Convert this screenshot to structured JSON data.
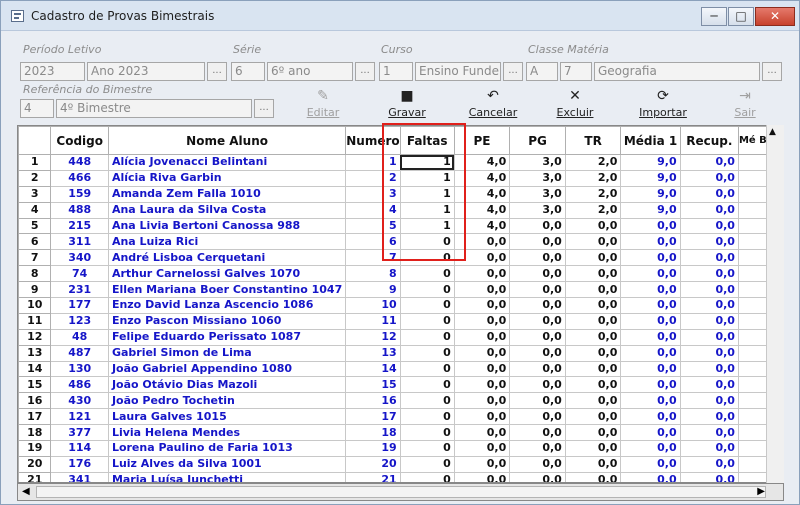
{
  "window": {
    "title": "Cadastro de Provas Bimestrais",
    "min": "─",
    "max": "□",
    "close": "✕"
  },
  "filters": {
    "periodo_label": "Período Letivo",
    "periodo_code": "2023",
    "periodo_name": "Ano 2023",
    "serie_label": "Série",
    "serie_code": "6",
    "serie_name": "6º ano",
    "curso_label": "Curso",
    "curso_code": "1",
    "curso_name": "Ensino Funde",
    "classe_label": "Classe Matéria",
    "classe_code": "A",
    "materia_code": "7",
    "materia_name": "Geografia",
    "ref_label": "Referência do Bimestre",
    "ref_code": "4",
    "ref_name": "4º Bimestre",
    "ellipsis": "..."
  },
  "toolbar": {
    "editar": "Editar",
    "gravar": "Gravar",
    "cancelar": "Cancelar",
    "excluir": "Excluir",
    "importar": "Importar",
    "sair": "Sair"
  },
  "grid": {
    "headers": [
      "Codigo",
      "Nome Aluno",
      "Numero",
      "Faltas",
      "PE",
      "PG",
      "TR",
      "Média 1",
      "Recup.",
      "Mé Bi"
    ],
    "rows": [
      {
        "n": "1",
        "codigo": "448",
        "nome": "Alícia Jovenacci Belintani",
        "numero": "1",
        "faltas": "1",
        "pe": "4,0",
        "pg": "3,0",
        "tr": "2,0",
        "media": "9,0",
        "recup": "0,0"
      },
      {
        "n": "2",
        "codigo": "466",
        "nome": "Alícia Riva Garbin",
        "numero": "2",
        "faltas": "1",
        "pe": "4,0",
        "pg": "3,0",
        "tr": "2,0",
        "media": "9,0",
        "recup": "0,0"
      },
      {
        "n": "3",
        "codigo": "159",
        "nome": "Amanda Zem Falla 1010",
        "numero": "3",
        "faltas": "1",
        "pe": "4,0",
        "pg": "3,0",
        "tr": "2,0",
        "media": "9,0",
        "recup": "0,0"
      },
      {
        "n": "4",
        "codigo": "488",
        "nome": "Ana Laura da Silva Costa",
        "numero": "4",
        "faltas": "1",
        "pe": "4,0",
        "pg": "3,0",
        "tr": "2,0",
        "media": "9,0",
        "recup": "0,0"
      },
      {
        "n": "5",
        "codigo": "215",
        "nome": "Ana Livia Bertoni Canossa 988",
        "numero": "5",
        "faltas": "1",
        "pe": "4,0",
        "pg": "0,0",
        "tr": "0,0",
        "media": "0,0",
        "recup": "0,0"
      },
      {
        "n": "6",
        "codigo": "311",
        "nome": "Ana Luiza Rici",
        "numero": "6",
        "faltas": "0",
        "pe": "0,0",
        "pg": "0,0",
        "tr": "0,0",
        "media": "0,0",
        "recup": "0,0"
      },
      {
        "n": "7",
        "codigo": "340",
        "nome": "André Lisboa Cerquetani",
        "numero": "7",
        "faltas": "0",
        "pe": "0,0",
        "pg": "0,0",
        "tr": "0,0",
        "media": "0,0",
        "recup": "0,0"
      },
      {
        "n": "8",
        "codigo": "74",
        "nome": "Arthur Carnelossi Galves 1070",
        "numero": "8",
        "faltas": "0",
        "pe": "0,0",
        "pg": "0,0",
        "tr": "0,0",
        "media": "0,0",
        "recup": "0,0"
      },
      {
        "n": "9",
        "codigo": "231",
        "nome": "Ellen Mariana Boer Constantino 1047",
        "numero": "9",
        "faltas": "0",
        "pe": "0,0",
        "pg": "0,0",
        "tr": "0,0",
        "media": "0,0",
        "recup": "0,0"
      },
      {
        "n": "10",
        "codigo": "177",
        "nome": "Enzo David Lanza Ascencio 1086",
        "numero": "10",
        "faltas": "0",
        "pe": "0,0",
        "pg": "0,0",
        "tr": "0,0",
        "media": "0,0",
        "recup": "0,0"
      },
      {
        "n": "11",
        "codigo": "123",
        "nome": "Enzo Pascon Missiano 1060",
        "numero": "11",
        "faltas": "0",
        "pe": "0,0",
        "pg": "0,0",
        "tr": "0,0",
        "media": "0,0",
        "recup": "0,0"
      },
      {
        "n": "12",
        "codigo": "48",
        "nome": "Felipe Eduardo Perissato 1087",
        "numero": "12",
        "faltas": "0",
        "pe": "0,0",
        "pg": "0,0",
        "tr": "0,0",
        "media": "0,0",
        "recup": "0,0"
      },
      {
        "n": "13",
        "codigo": "487",
        "nome": "Gabriel Simon de Lima",
        "numero": "13",
        "faltas": "0",
        "pe": "0,0",
        "pg": "0,0",
        "tr": "0,0",
        "media": "0,0",
        "recup": "0,0"
      },
      {
        "n": "14",
        "codigo": "130",
        "nome": "João Gabriel Appendino 1080",
        "numero": "14",
        "faltas": "0",
        "pe": "0,0",
        "pg": "0,0",
        "tr": "0,0",
        "media": "0,0",
        "recup": "0,0"
      },
      {
        "n": "15",
        "codigo": "486",
        "nome": "João Otávio Dias Mazoli",
        "numero": "15",
        "faltas": "0",
        "pe": "0,0",
        "pg": "0,0",
        "tr": "0,0",
        "media": "0,0",
        "recup": "0,0"
      },
      {
        "n": "16",
        "codigo": "430",
        "nome": "João Pedro Tochetin",
        "numero": "16",
        "faltas": "0",
        "pe": "0,0",
        "pg": "0,0",
        "tr": "0,0",
        "media": "0,0",
        "recup": "0,0"
      },
      {
        "n": "17",
        "codigo": "121",
        "nome": "Laura Galves 1015",
        "numero": "17",
        "faltas": "0",
        "pe": "0,0",
        "pg": "0,0",
        "tr": "0,0",
        "media": "0,0",
        "recup": "0,0"
      },
      {
        "n": "18",
        "codigo": "377",
        "nome": "Livia Helena Mendes",
        "numero": "18",
        "faltas": "0",
        "pe": "0,0",
        "pg": "0,0",
        "tr": "0,0",
        "media": "0,0",
        "recup": "0,0"
      },
      {
        "n": "19",
        "codigo": "114",
        "nome": "Lorena Paulino de Faria 1013",
        "numero": "19",
        "faltas": "0",
        "pe": "0,0",
        "pg": "0,0",
        "tr": "0,0",
        "media": "0,0",
        "recup": "0,0"
      },
      {
        "n": "20",
        "codigo": "176",
        "nome": "Luiz Alves da Silva 1001",
        "numero": "20",
        "faltas": "0",
        "pe": "0,0",
        "pg": "0,0",
        "tr": "0,0",
        "media": "0,0",
        "recup": "0,0"
      },
      {
        "n": "21",
        "codigo": "341",
        "nome": "Maria Luísa Junchetti",
        "numero": "21",
        "faltas": "0",
        "pe": "0,0",
        "pg": "0,0",
        "tr": "0,0",
        "media": "0,0",
        "recup": "0,0"
      }
    ]
  },
  "colors": {
    "accent_text": "#1515c8",
    "highlight": "#e0201b"
  }
}
